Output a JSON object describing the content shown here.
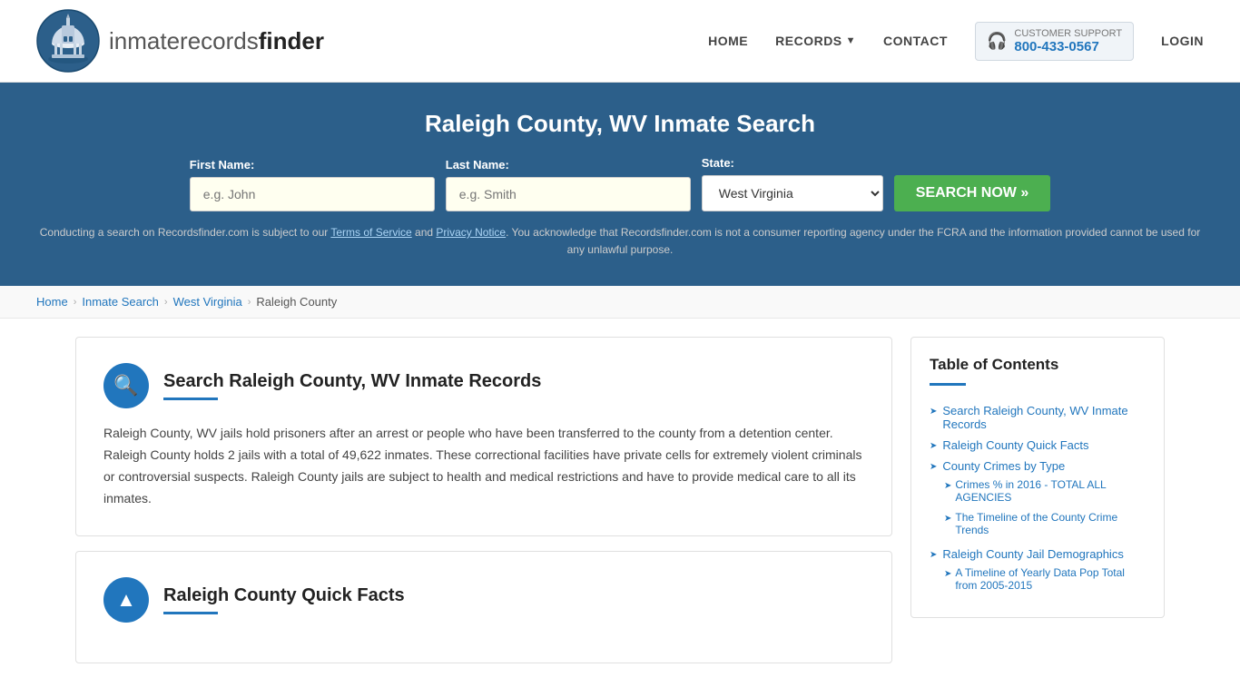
{
  "header": {
    "logo_text_light": "inmaterecords",
    "logo_text_bold": "finder",
    "nav": {
      "home": "HOME",
      "records": "RECORDS",
      "contact": "CONTACT",
      "login": "LOGIN"
    },
    "support": {
      "label": "CUSTOMER SUPPORT",
      "phone": "800-433-0567"
    }
  },
  "hero": {
    "title": "Raleigh County, WV Inmate Search",
    "fields": {
      "first_name_label": "First Name:",
      "first_name_placeholder": "e.g. John",
      "last_name_label": "Last Name:",
      "last_name_placeholder": "e.g. Smith",
      "state_label": "State:",
      "state_value": "West Virginia"
    },
    "search_button": "SEARCH NOW »",
    "disclaimer": "Conducting a search on Recordsfinder.com is subject to our Terms of Service and Privacy Notice. You acknowledge that Recordsfinder.com is not a consumer reporting agency under the FCRA and the information provided cannot be used for any unlawful purpose."
  },
  "breadcrumb": {
    "items": [
      "Home",
      "Inmate Search",
      "West Virginia",
      "Raleigh County"
    ]
  },
  "main_section": {
    "card1": {
      "title": "Search Raleigh County, WV Inmate Records",
      "body": "Raleigh County, WV jails hold prisoners after an arrest or people who have been transferred to the county from a detention center. Raleigh County holds 2 jails with a total of 49,622 inmates. These correctional facilities have private cells for extremely violent criminals or controversial suspects. Raleigh County jails are subject to health and medical restrictions and have to provide medical care to all its inmates."
    },
    "card2": {
      "title": "Raleigh County Quick Facts"
    }
  },
  "toc": {
    "title": "Table of Contents",
    "items": [
      {
        "label": "Search Raleigh County, WV Inmate Records",
        "sub": []
      },
      {
        "label": "Raleigh County Quick Facts",
        "sub": []
      },
      {
        "label": "County Crimes by Type",
        "sub": [
          "Crimes % in 2016 - TOTAL ALL AGENCIES",
          "The Timeline of the County Crime Trends"
        ]
      },
      {
        "label": "Raleigh County Jail Demographics",
        "sub": [
          "A Timeline of Yearly Data Pop Total from 2005-2015"
        ]
      }
    ]
  }
}
